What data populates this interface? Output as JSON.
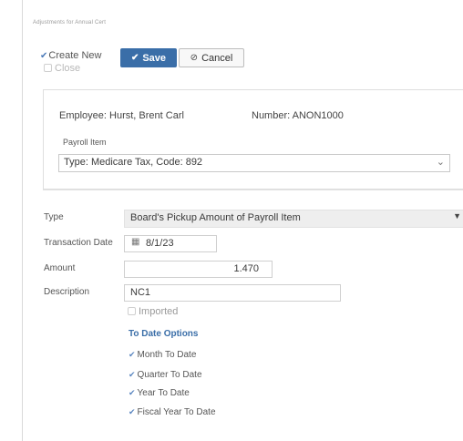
{
  "breadcrumb": "Adjustments for Annual Cert",
  "toolbar": {
    "create_new_label": "Create New",
    "close_label": "Close",
    "save_label": "Save",
    "cancel_label": "Cancel"
  },
  "employee": {
    "employee_text": "Employee: Hurst, Brent Carl",
    "number_text": "Number: ANON1000",
    "payroll_item_label": "Payroll Item",
    "payroll_item_value": "Type: Medicare Tax, Code: 892"
  },
  "form": {
    "type_label": "Type",
    "type_value": "Board's Pickup Amount of Payroll Item",
    "transaction_date_label": "Transaction Date",
    "transaction_date_value": "8/1/23",
    "amount_label": "Amount",
    "amount_value": "1.470",
    "description_label": "Description",
    "description_value": "NC1",
    "imported_label": "Imported"
  },
  "to_date": {
    "title": "To Date Options",
    "options": [
      "Month To Date",
      "Quarter To Date",
      "Year To Date",
      "Fiscal Year To Date"
    ]
  },
  "colors": {
    "accent": "#3a6ea8",
    "border": "#cfcfcf"
  }
}
